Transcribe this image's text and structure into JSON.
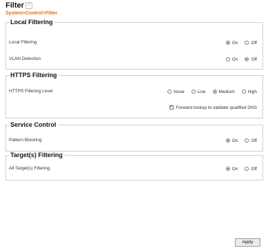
{
  "page": {
    "title": "Filter",
    "breadcrumb": "System>Control>Filter"
  },
  "sections": {
    "local": {
      "legend": "Local Filtering",
      "rows": [
        {
          "label": "Local Filtering",
          "options": [
            "On",
            "Off"
          ],
          "selected": "On"
        },
        {
          "label": "VLAN Detection",
          "options": [
            "On",
            "Off"
          ],
          "selected": "Off"
        }
      ]
    },
    "https": {
      "legend": "HTTPS Filtering",
      "rows": [
        {
          "label": "HTTPS Filtering Level",
          "options": [
            "None",
            "Low",
            "Medium",
            "High"
          ],
          "selected": "Medium"
        }
      ],
      "forward_lookup_label": "Forward lookup to validate qualified DNS",
      "forward_lookup_checked": true
    },
    "service": {
      "legend": "Service Control",
      "rows": [
        {
          "label": "Pattern Blocking",
          "options": [
            "On",
            "Off"
          ],
          "selected": "On"
        }
      ]
    },
    "targets": {
      "legend": "Target(s) Filtering",
      "rows": [
        {
          "label": "All Target(s) Filtering",
          "options": [
            "On",
            "Off"
          ],
          "selected": "On"
        }
      ]
    }
  },
  "footer": {
    "apply_label": "Apply"
  }
}
